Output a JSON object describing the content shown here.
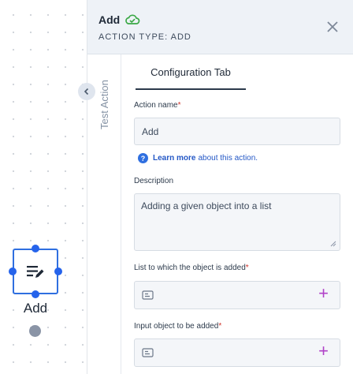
{
  "canvas": {
    "node_label": "Add"
  },
  "header": {
    "title": "Add",
    "subtitle": "ACTION TYPE: ADD",
    "status_icon": "cloud-check-icon",
    "close_icon": "close-icon"
  },
  "side_tab": {
    "label": "Test Action"
  },
  "tabs": {
    "active": "Configuration Tab"
  },
  "form": {
    "action_name_label": "Action name",
    "action_name_value": "Add",
    "required_mark": "*",
    "learn_more_link": "Learn more",
    "learn_more_rest": "about this action.",
    "description_label": "Description",
    "description_value": "Adding a given object into a list",
    "list_label": "List to which the object is added",
    "input_label": "Input object to be added",
    "plus_symbol": "+"
  },
  "colors": {
    "accent": "#2f6fe0",
    "plus": "#b042c8",
    "cloud": "#3aa845",
    "required": "#d0342c"
  }
}
